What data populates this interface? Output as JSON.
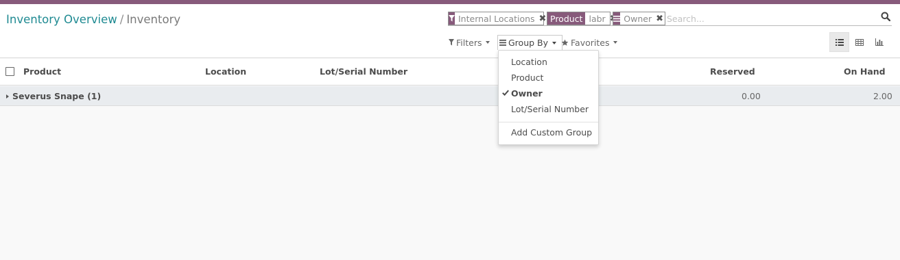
{
  "breadcrumb": {
    "parent": "Inventory Overview",
    "separator": "/",
    "current": "Inventory"
  },
  "search": {
    "facets": [
      {
        "category": "filter-icon",
        "value": "Internal Locations"
      },
      {
        "category": "Product",
        "value": "labr"
      },
      {
        "category": "group-by-icon",
        "value": "Owner"
      }
    ],
    "placeholder": "Search..."
  },
  "toolbar": {
    "filters_label": "Filters",
    "group_by_label": "Group By",
    "favorites_label": "Favorites"
  },
  "group_by_menu": {
    "items": [
      {
        "label": "Location",
        "selected": false
      },
      {
        "label": "Product",
        "selected": false
      },
      {
        "label": "Owner",
        "selected": true
      },
      {
        "label": "Lot/Serial Number",
        "selected": false
      }
    ],
    "custom_label": "Add Custom Group"
  },
  "table": {
    "columns": [
      "Product",
      "Location",
      "Lot/Serial Number",
      "Reserved",
      "On Hand"
    ],
    "groups": [
      {
        "label": "Severus Snape (1)",
        "reserved": "0.00",
        "on_hand": "2.00"
      }
    ]
  },
  "colors": {
    "brand": "#875a7b",
    "link": "#1f8a92"
  }
}
